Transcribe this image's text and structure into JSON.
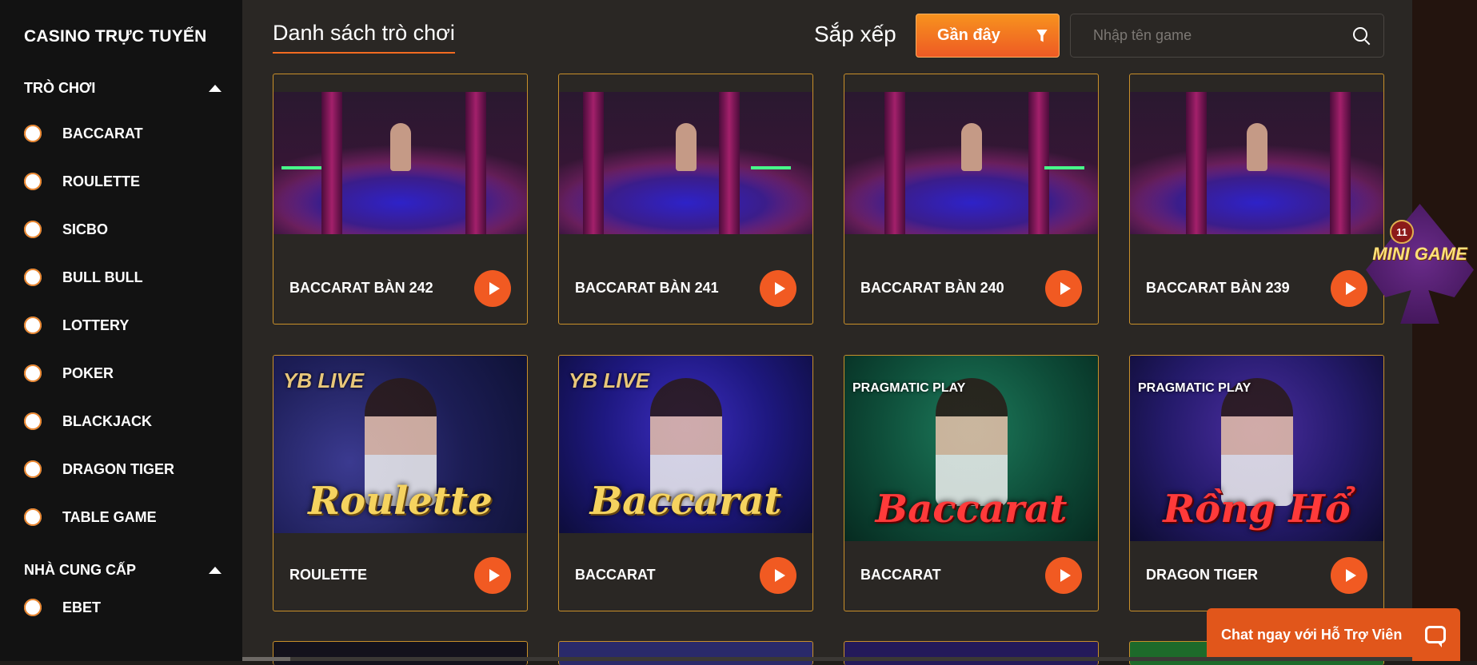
{
  "sidebar": {
    "title": "CASINO TRỰC TUYẾN",
    "games_heading": "TRÒ CHƠI",
    "games": [
      "BACCARAT",
      "ROULETTE",
      "SICBO",
      "BULL BULL",
      "LOTTERY",
      "POKER",
      "BLACKJACK",
      "DRAGON TIGER",
      "TABLE GAME"
    ],
    "providers_heading": "NHÀ CUNG CẤP",
    "providers": [
      "EBET"
    ]
  },
  "header": {
    "title": "Danh sách trò chơi",
    "sort_label": "Sắp xếp",
    "sort_value": "Gần đây",
    "search_placeholder": "Nhập tên game"
  },
  "games": [
    {
      "name": "BACCARAT BÀN 242"
    },
    {
      "name": "BACCARAT BÀN 241"
    },
    {
      "name": "BACCARAT BÀN 240"
    },
    {
      "name": "BACCARAT BÀN 239"
    },
    {
      "name": "ROULETTE",
      "brand": "YB LIVE",
      "art_text": "Roulette"
    },
    {
      "name": "BACCARAT",
      "brand": "YB LIVE",
      "art_text": "Baccarat"
    },
    {
      "name": "BACCARAT",
      "brand": "PRAGMATIC PLAY",
      "art_text": "Baccarat"
    },
    {
      "name": "DRAGON TIGER",
      "brand": "PRAGMATIC PLAY",
      "art_text": "Rồng Hổ"
    }
  ],
  "mini_game": {
    "label": "MINI GAME",
    "badge": "11"
  },
  "chat": {
    "label": "Chat ngay với Hỗ Trợ Viên"
  },
  "colors": {
    "accent": "#f15a22",
    "card_border": "#c9902a",
    "sidebar_bg": "#121212",
    "main_bg": "#2a2724"
  }
}
